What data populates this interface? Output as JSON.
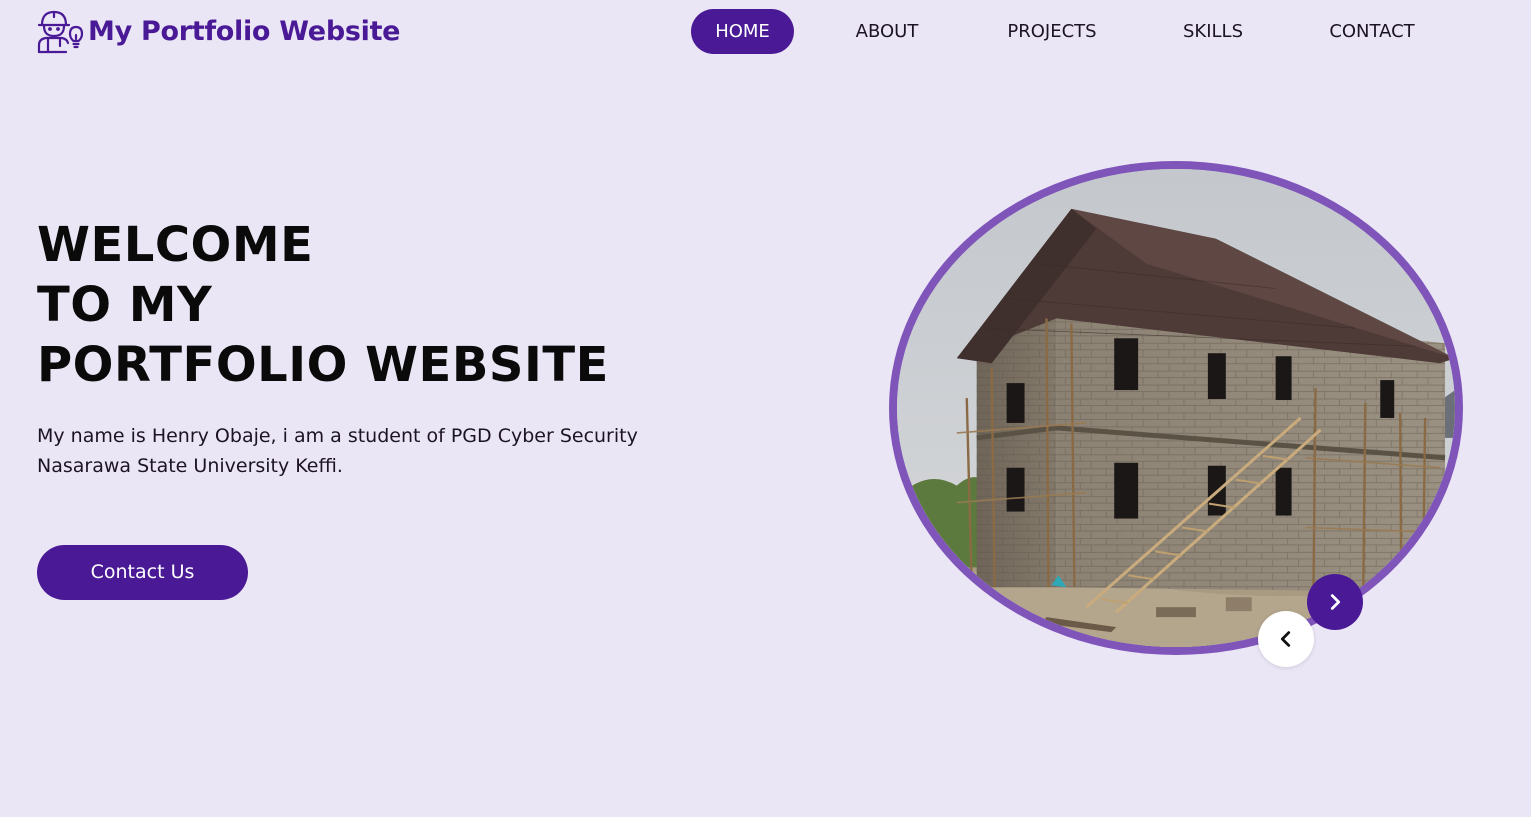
{
  "brand": {
    "title": "My Portfolio Website",
    "icon": "engineer-avatar-icon"
  },
  "nav": {
    "items": [
      {
        "label": "HOME",
        "active": true
      },
      {
        "label": "ABOUT",
        "active": false
      },
      {
        "label": "PROJECTS",
        "active": false
      },
      {
        "label": "SKILLS",
        "active": false
      },
      {
        "label": "CONTACT",
        "active": false
      }
    ]
  },
  "hero": {
    "title_lines": [
      "WELCOME",
      "TO MY",
      "PORTFOLIO WEBSITE"
    ],
    "description": "My name is Henry Obaje, i am a student of PGD Cyber Security Nasarawa State University Keffi.",
    "cta_label": "Contact Us"
  },
  "carousel": {
    "image": "building-under-construction",
    "prev_icon": "chevron-left-icon",
    "next_icon": "chevron-right-icon"
  },
  "colors": {
    "background": "#ebe6f6",
    "accent": "#4a1a96",
    "frame_border": "#7f55b9",
    "text": "#0a0a0a"
  }
}
